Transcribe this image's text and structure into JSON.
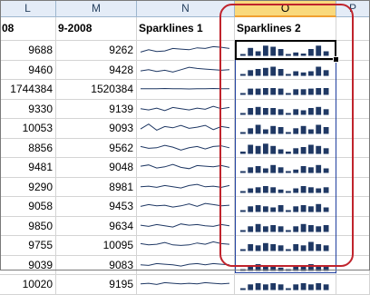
{
  "columns": [
    {
      "letter": "L"
    },
    {
      "letter": "M"
    },
    {
      "letter": "N"
    },
    {
      "letter": "O"
    },
    {
      "letter": "P"
    }
  ],
  "header_row": {
    "l": "08",
    "m": "9-2008",
    "n": "Sparklines 1",
    "o": "Sparklines 2"
  },
  "rows": [
    {
      "l": "9688",
      "m": "9262"
    },
    {
      "l": "9460",
      "m": "9428"
    },
    {
      "l": "1744384",
      "m": "1520384"
    },
    {
      "l": "9330",
      "m": "9139"
    },
    {
      "l": "10053",
      "m": "9093"
    },
    {
      "l": "8856",
      "m": "9562"
    },
    {
      "l": "9481",
      "m": "9048"
    },
    {
      "l": "9290",
      "m": "8981"
    },
    {
      "l": "9058",
      "m": "9453"
    },
    {
      "l": "9850",
      "m": "9634"
    },
    {
      "l": "9755",
      "m": "10095"
    },
    {
      "l": "9039",
      "m": "9083"
    },
    {
      "l": "10020",
      "m": "9195"
    }
  ],
  "sparkline_lines": [
    [
      0.3,
      0.5,
      0.35,
      0.4,
      0.6,
      0.55,
      0.5,
      0.65,
      0.6,
      0.75,
      0.7,
      0.6
    ],
    [
      0.4,
      0.5,
      0.35,
      0.45,
      0.3,
      0.5,
      0.7,
      0.6,
      0.55,
      0.5,
      0.45,
      0.5
    ],
    [
      0.5,
      0.5,
      0.5,
      0.52,
      0.5,
      0.5,
      0.48,
      0.5,
      0.5,
      0.52,
      0.5,
      0.5
    ],
    [
      0.5,
      0.4,
      0.55,
      0.35,
      0.6,
      0.5,
      0.4,
      0.55,
      0.45,
      0.7,
      0.5,
      0.6
    ],
    [
      0.4,
      0.8,
      0.3,
      0.6,
      0.5,
      0.7,
      0.45,
      0.55,
      0.7,
      0.35,
      0.6,
      0.5
    ],
    [
      0.6,
      0.45,
      0.5,
      0.7,
      0.55,
      0.3,
      0.5,
      0.6,
      0.4,
      0.6,
      0.65,
      0.5
    ],
    [
      0.55,
      0.65,
      0.4,
      0.5,
      0.7,
      0.45,
      0.35,
      0.6,
      0.55,
      0.5,
      0.6,
      0.45
    ],
    [
      0.5,
      0.55,
      0.45,
      0.6,
      0.5,
      0.4,
      0.6,
      0.7,
      0.5,
      0.55,
      0.45,
      0.6
    ],
    [
      0.45,
      0.6,
      0.5,
      0.55,
      0.4,
      0.5,
      0.65,
      0.45,
      0.7,
      0.6,
      0.5,
      0.55
    ],
    [
      0.55,
      0.45,
      0.6,
      0.5,
      0.4,
      0.65,
      0.55,
      0.6,
      0.5,
      0.45,
      0.6,
      0.5
    ],
    [
      0.6,
      0.5,
      0.55,
      0.7,
      0.5,
      0.45,
      0.5,
      0.65,
      0.55,
      0.75,
      0.6,
      0.55
    ],
    [
      0.5,
      0.45,
      0.6,
      0.55,
      0.5,
      0.4,
      0.55,
      0.6,
      0.5,
      0.6,
      0.55,
      0.5
    ],
    [
      0.5,
      0.55,
      0.45,
      0.6,
      0.55,
      0.5,
      0.55,
      0.5,
      0.6,
      0.55,
      0.5,
      0.55
    ]
  ],
  "sparkline_bars": [
    [
      0.15,
      0.7,
      0.4,
      0.9,
      0.8,
      0.6,
      0.15,
      0.3,
      0.2,
      0.6,
      0.9,
      0.4
    ],
    [
      0.15,
      0.5,
      0.6,
      0.7,
      0.8,
      0.6,
      0.15,
      0.4,
      0.3,
      0.4,
      0.8,
      0.5
    ],
    [
      0.15,
      0.55,
      0.55,
      0.6,
      0.6,
      0.55,
      0.15,
      0.5,
      0.5,
      0.55,
      0.6,
      0.6
    ],
    [
      0.15,
      0.6,
      0.7,
      0.6,
      0.6,
      0.5,
      0.15,
      0.5,
      0.4,
      0.6,
      0.7,
      0.5
    ],
    [
      0.15,
      0.5,
      0.8,
      0.4,
      0.7,
      0.6,
      0.15,
      0.5,
      0.7,
      0.4,
      0.8,
      0.6
    ],
    [
      0.2,
      0.8,
      0.7,
      0.9,
      0.7,
      0.4,
      0.2,
      0.5,
      0.6,
      0.8,
      0.7,
      0.5
    ],
    [
      0.15,
      0.5,
      0.6,
      0.4,
      0.7,
      0.5,
      0.15,
      0.3,
      0.6,
      0.5,
      0.7,
      0.4
    ],
    [
      0.15,
      0.4,
      0.5,
      0.6,
      0.5,
      0.3,
      0.15,
      0.4,
      0.6,
      0.5,
      0.4,
      0.5
    ],
    [
      0.15,
      0.5,
      0.6,
      0.5,
      0.4,
      0.6,
      0.15,
      0.5,
      0.6,
      0.5,
      0.7,
      0.4
    ],
    [
      0.15,
      0.5,
      0.7,
      0.5,
      0.6,
      0.5,
      0.15,
      0.5,
      0.7,
      0.6,
      0.5,
      0.6
    ],
    [
      0.15,
      0.6,
      0.5,
      0.7,
      0.6,
      0.5,
      0.15,
      0.6,
      0.5,
      0.8,
      0.6,
      0.5
    ],
    [
      0.15,
      0.4,
      0.6,
      0.5,
      0.4,
      0.3,
      0.15,
      0.4,
      0.5,
      0.6,
      0.5,
      0.4
    ],
    [
      0.15,
      0.5,
      0.6,
      0.5,
      0.6,
      0.5,
      0.15,
      0.5,
      0.6,
      0.5,
      0.6,
      0.5
    ]
  ],
  "colors": {
    "bar": "#1f3864",
    "line": "#1f3864",
    "highlight": "#c0232c",
    "header_bg": "#e4ecf7",
    "selected_header_bg": "#f9d97c"
  }
}
